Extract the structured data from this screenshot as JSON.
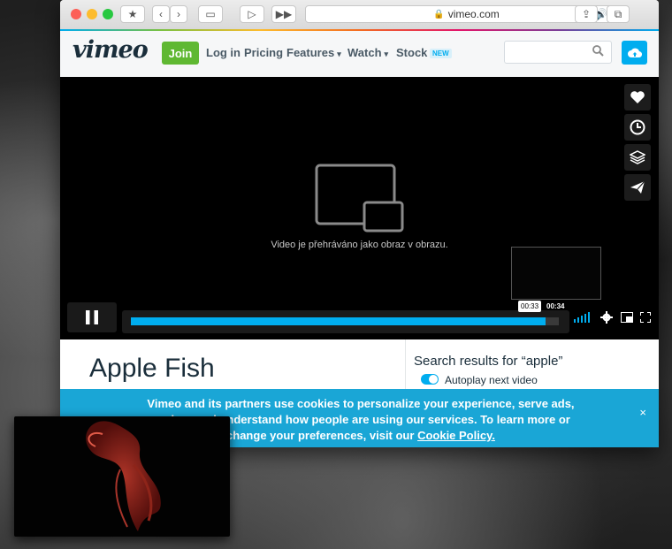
{
  "browser": {
    "url": "vimeo.com"
  },
  "header": {
    "logo": "vimeo",
    "join_label": "Join",
    "login_label": "Log in",
    "pricing_label": "Pricing",
    "features_label": "Features",
    "watch_label": "Watch",
    "stock_label": "Stock",
    "new_badge": "NEW",
    "search_placeholder": ""
  },
  "player": {
    "pip_message": "Video je přehráváno jako obraz v obrazu.",
    "current_time": "00:33",
    "total_time": "00:34",
    "progress": 0.97,
    "side_buttons": [
      "heart-icon",
      "clock-icon",
      "layers-icon",
      "send-icon"
    ]
  },
  "content": {
    "video_title": "Apple Fish",
    "results_title": "Search results for “apple”",
    "autoplay_label": "Autoplay next video"
  },
  "cookie": {
    "text_before": "Vimeo and its partners use cookies to personalize your experience, serve ads, analyze and understand how people are using our services. To learn more or change your preferences, visit our ",
    "link": "Cookie Policy.",
    "close": "×"
  },
  "colors": {
    "accent": "#00adef",
    "join": "#5fb832",
    "cookie_bg": "#1aa6d6"
  }
}
